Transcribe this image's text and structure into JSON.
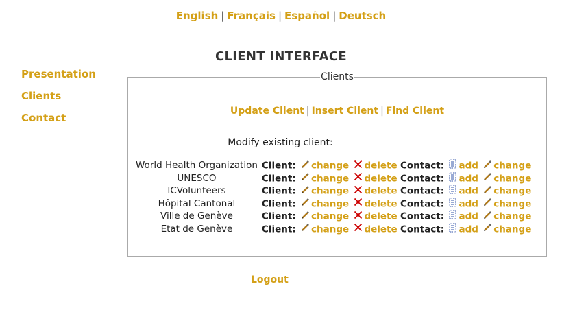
{
  "languages": [
    "English",
    "Français",
    "Español",
    "Deutsch"
  ],
  "page_title": "CLIENT INTERFACE",
  "sidebar": {
    "items": [
      {
        "label": "Presentation"
      },
      {
        "label": "Clients"
      },
      {
        "label": "Contact"
      }
    ]
  },
  "panel": {
    "legend": "Clients",
    "actions": [
      "Update Client",
      "Insert Client",
      "Find Client"
    ],
    "section_heading": "Modify existing client:"
  },
  "row_labels": {
    "client": "Client:",
    "change": "change",
    "delete": "delete",
    "contact": "Contact:",
    "add": "add"
  },
  "clients": [
    {
      "name": "World Health Organization"
    },
    {
      "name": "UNESCO"
    },
    {
      "name": "ICVolunteers"
    },
    {
      "name": "Hôpital Cantonal"
    },
    {
      "name": "Ville de Genève"
    },
    {
      "name": "Etat de Genève"
    }
  ],
  "footer": {
    "logout": "Logout"
  },
  "colors": {
    "link": "#d4a017",
    "delete_icon": "#cc0000"
  }
}
